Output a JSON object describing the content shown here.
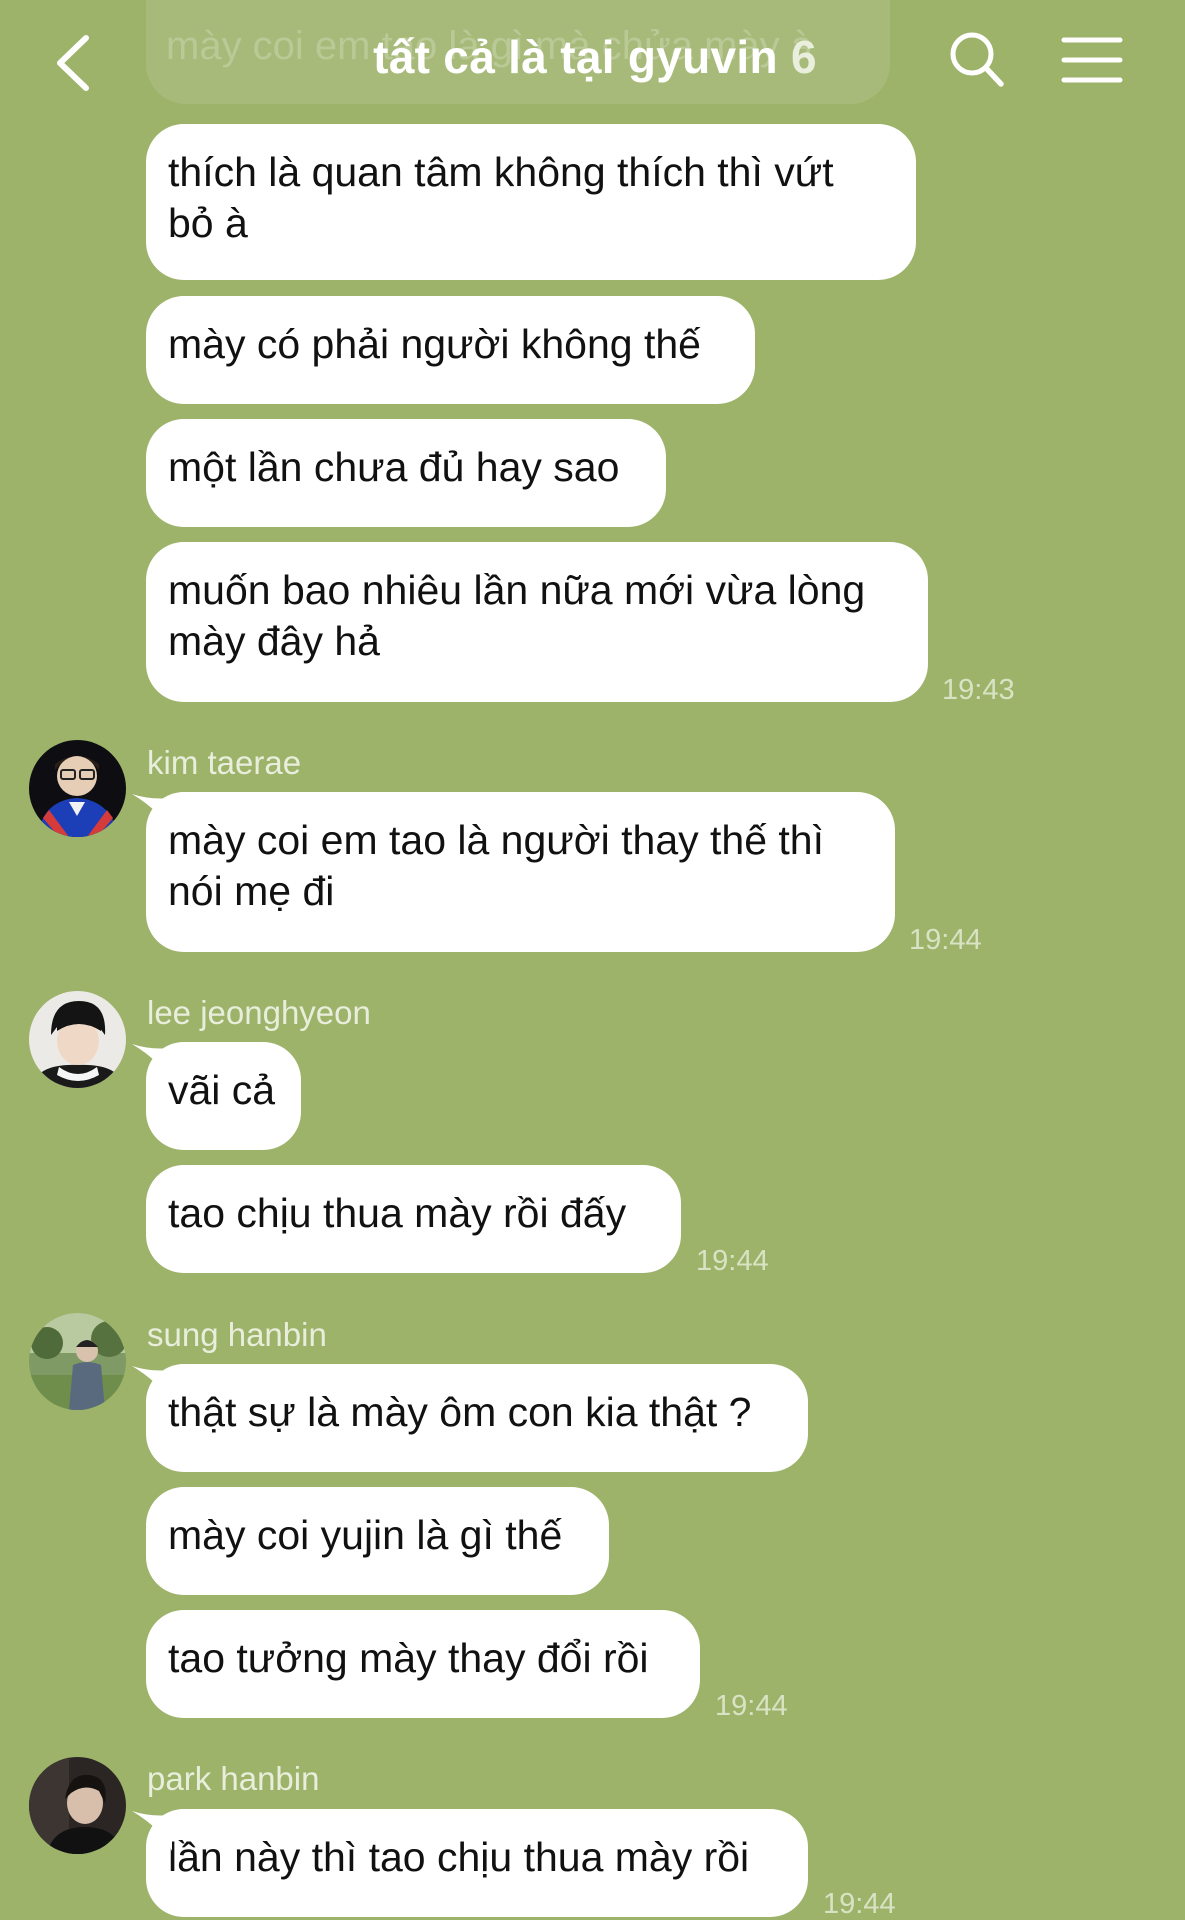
{
  "header": {
    "title": "tất cả là tại gyuvin",
    "member_count": "6",
    "back_icon": "chevron-left-icon",
    "search_icon": "search-icon",
    "menu_icon": "hamburger-menu-icon",
    "overlap_text": "mày coi em tao là người thay thế thì nói mẹ đi, mày coi em tao là gì mà chửa mày à"
  },
  "messages": {
    "m1": "thích là quan tâm không thích thì vứt",
    "m1b": "bỏ à",
    "m2": "mày có phải người không thế",
    "m3": "một lần chưa đủ hay sao",
    "m4": "muốn bao nhiêu lần nữa mới vừa lòng",
    "m4b": "mày đây hả",
    "t1": "19:43",
    "s1": "kim taerae",
    "m5": "mày coi em tao là người thay thế thì",
    "m5b": "nói mẹ đi",
    "t2": "19:44",
    "s2": "lee jeonghyeon",
    "m6": "vãi cả",
    "m7": "tao chịu thua mày rồi đấy",
    "t3": "19:44",
    "s3": "sung hanbin",
    "m8": "thật sự là mày ôm con kia thật ?",
    "m9": "mày coi yujin là gì thế",
    "m10": "tao tưởng mày thay đổi rồi",
    "t4": "19:44",
    "s4": "park hanbin",
    "m11": "lần này thì tao chịu thua mày rồi",
    "t5": "19:44"
  },
  "colors": {
    "background": "#9db36a",
    "bubble": "#ffffff",
    "text": "#111111",
    "timestamp": "#d9e3c4",
    "sender": "#e8eedb"
  }
}
